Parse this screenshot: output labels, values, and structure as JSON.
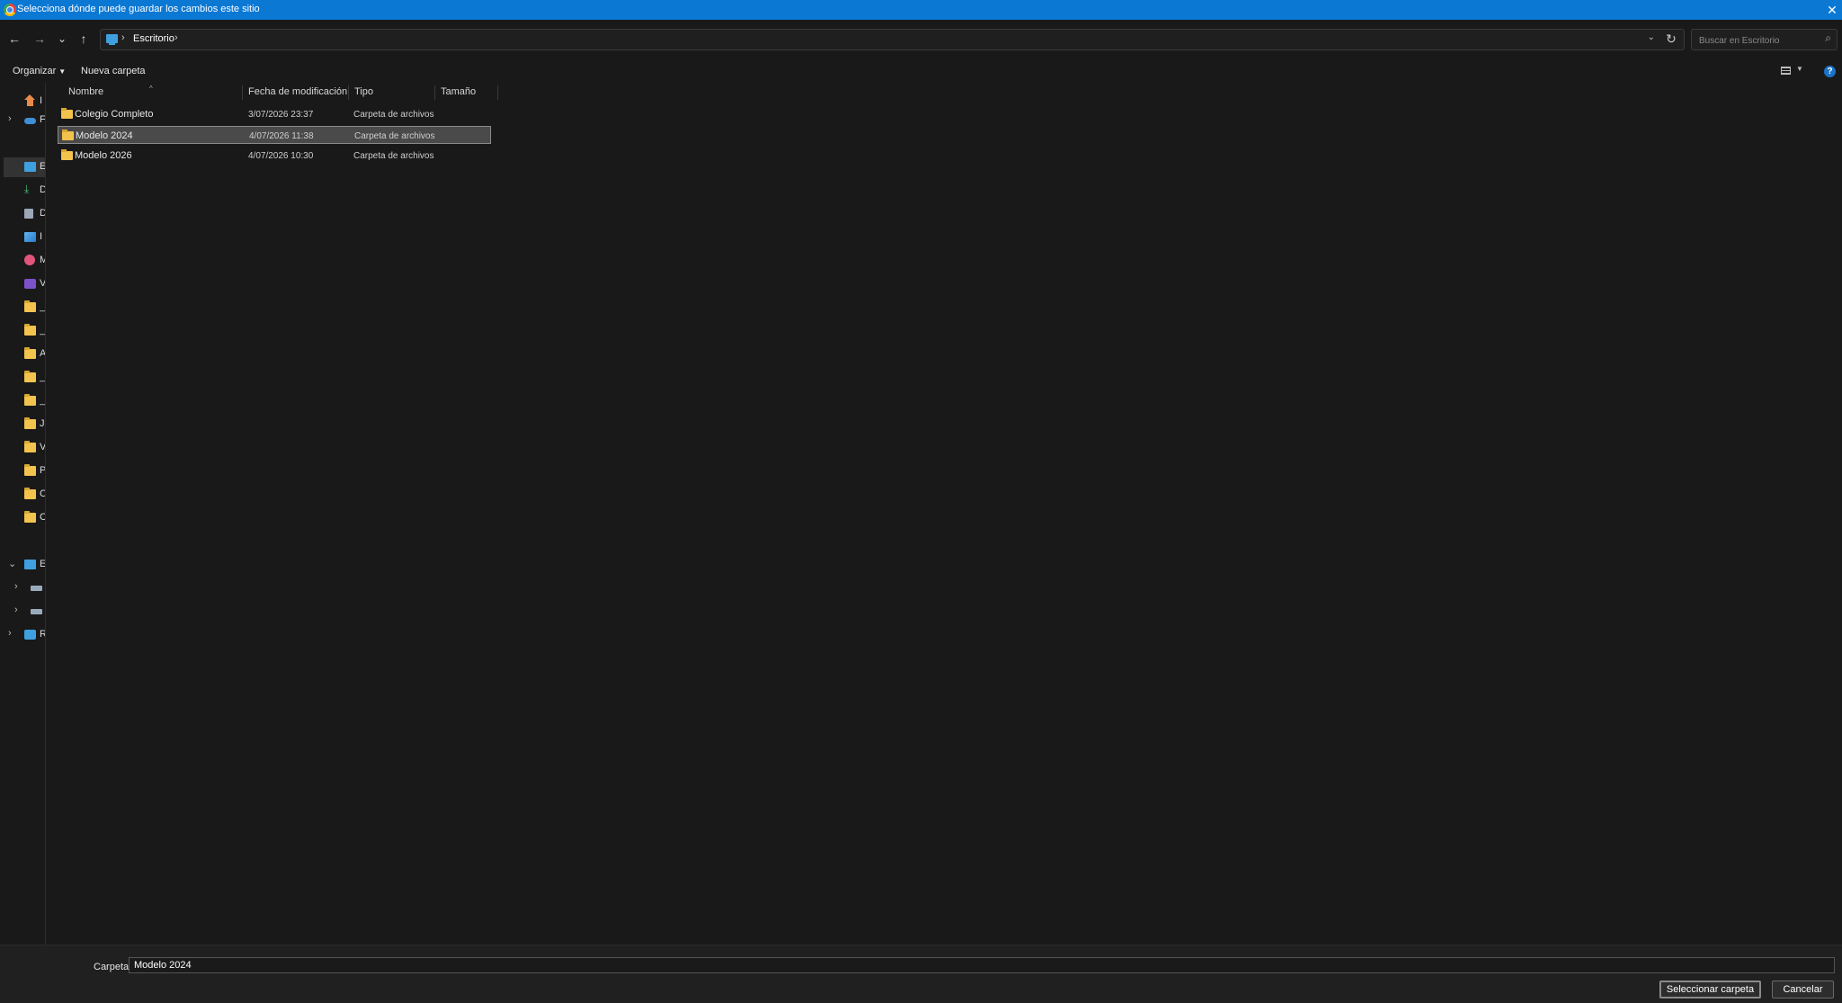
{
  "window": {
    "title": "Selecciona dónde puede guardar los cambios este sitio",
    "close_glyph": "✕"
  },
  "nav": {
    "back": "←",
    "forward": "→",
    "recent": "⌄",
    "up": "↑",
    "refresh": "↻",
    "breadcrumb_sep": "›",
    "address_dropdown": "⌄"
  },
  "address": {
    "crumbs": [
      "Escritorio"
    ]
  },
  "search": {
    "placeholder": "Buscar en Escritorio",
    "icon": "search-icon"
  },
  "command_bar": {
    "organize": "Organizar",
    "new_folder": "Nueva carpeta",
    "help": "?"
  },
  "columns": [
    "Nombre",
    "Fecha de modificación",
    "Tipo",
    "Tamaño"
  ],
  "files": [
    {
      "name": "Colegio Completo",
      "modified": "3/07/2026 23:37",
      "type": "Carpeta de archivos",
      "size": "",
      "selected": false
    },
    {
      "name": "Modelo 2024",
      "modified": "4/07/2026 11:38",
      "type": "Carpeta de archivos",
      "size": "",
      "selected": true
    },
    {
      "name": "Modelo 2026",
      "modified": "4/07/2026 10:30",
      "type": "Carpeta de archivos",
      "size": "",
      "selected": false
    }
  ],
  "nav_pane": [
    {
      "label": "I",
      "icon": "home-icon",
      "expander": ""
    },
    {
      "label": "F",
      "icon": "cloud-icon",
      "expander": "›"
    },
    {
      "label": "E",
      "icon": "desktop-icon",
      "expander": "",
      "selected": true
    },
    {
      "label": "D",
      "icon": "download-icon",
      "expander": ""
    },
    {
      "label": "D",
      "icon": "document-icon",
      "expander": ""
    },
    {
      "label": "I",
      "icon": "pictures-icon",
      "expander": ""
    },
    {
      "label": "M",
      "icon": "music-icon",
      "expander": ""
    },
    {
      "label": "V",
      "icon": "video-icon",
      "expander": ""
    },
    {
      "label": "_",
      "icon": "folder-icon",
      "expander": ""
    },
    {
      "label": "_",
      "icon": "folder-icon",
      "expander": ""
    },
    {
      "label": "A",
      "icon": "folder-icon",
      "expander": ""
    },
    {
      "label": "_",
      "icon": "folder-icon",
      "expander": ""
    },
    {
      "label": "_",
      "icon": "folder-icon",
      "expander": ""
    },
    {
      "label": "J",
      "icon": "folder-icon",
      "expander": ""
    },
    {
      "label": "V",
      "icon": "folder-icon",
      "expander": ""
    },
    {
      "label": "P",
      "icon": "folder-icon",
      "expander": ""
    },
    {
      "label": "C",
      "icon": "folder-icon",
      "expander": ""
    },
    {
      "label": "C",
      "icon": "folder-icon",
      "expander": ""
    },
    {
      "label": "E",
      "icon": "pc-icon",
      "expander": "⌄"
    },
    {
      "label": "",
      "icon": "drive-icon",
      "expander": "›"
    },
    {
      "label": "",
      "icon": "drive-icon",
      "expander": "›"
    },
    {
      "label": "R",
      "icon": "network-icon",
      "expander": "›"
    }
  ],
  "footer": {
    "folder_label": "Carpeta:",
    "folder_value": "Modelo 2024",
    "select_button": "Seleccionar carpeta",
    "cancel_button": "Cancelar"
  },
  "colors": {
    "title_bar": "#0b78d4",
    "background": "#191919",
    "folder": "#f2c44d",
    "selection": "#4a4a4a"
  }
}
